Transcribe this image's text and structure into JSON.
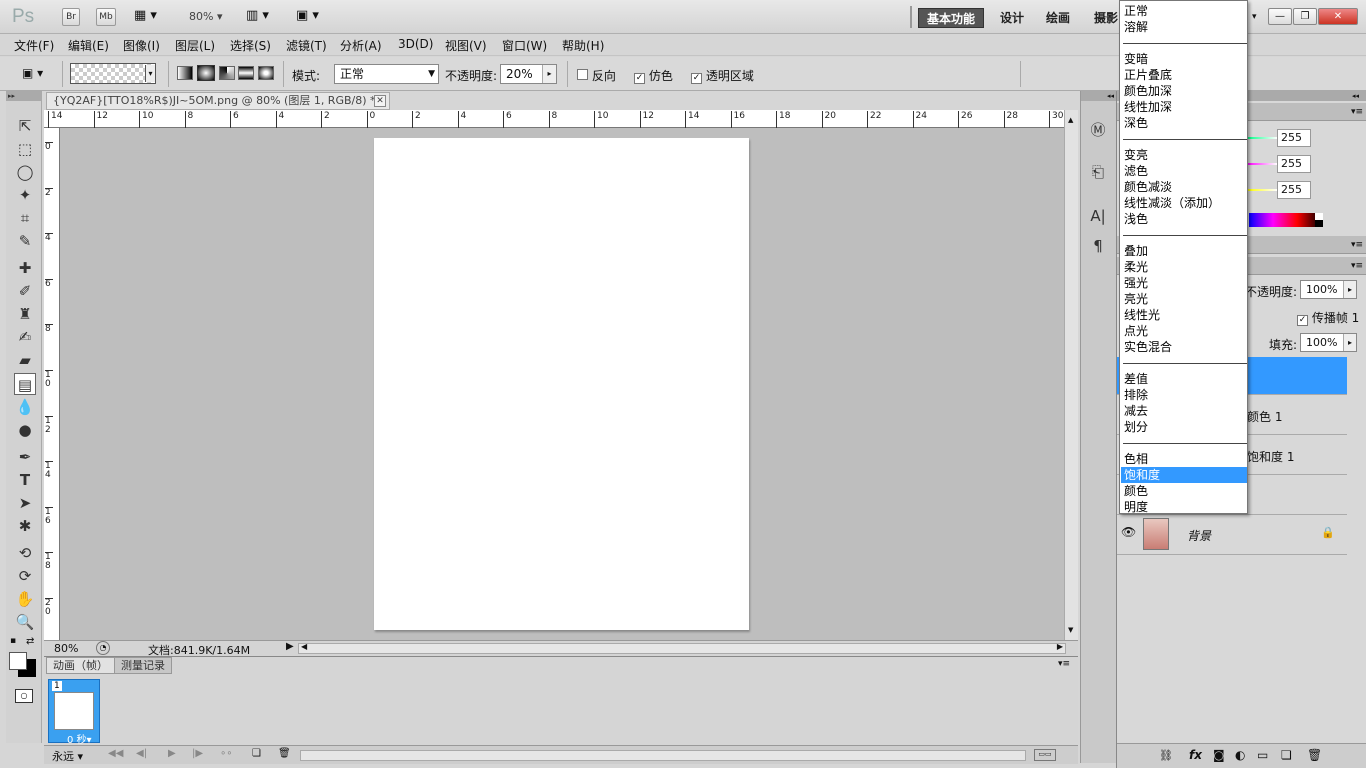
{
  "app": {
    "logo": "Ps",
    "bridge": "Br",
    "minibridge": "Mb",
    "zoom": "80%"
  },
  "workspaces": {
    "basic": "基本功能",
    "design": "设计",
    "paint": "绘画",
    "photo": "摄影"
  },
  "menus": [
    "文件(F)",
    "编辑(E)",
    "图像(I)",
    "图层(L)",
    "选择(S)",
    "滤镜(T)",
    "分析(A)",
    "3D(D)",
    "视图(V)",
    "窗口(W)",
    "帮助(H)"
  ],
  "options": {
    "mode_label": "模式:",
    "mode_value": "正常",
    "opacity_label": "不透明度:",
    "opacity_value": "20%",
    "reverse": "反向",
    "dither": "仿色",
    "transparency": "透明区域"
  },
  "document": {
    "tab_title": "{YQ2AF}[TTO18%R$)JI~5OM.png @ 80% (图层 1, RGB/8) *",
    "zoom": "80%",
    "doc_size": "文档:841.9K/1.64M"
  },
  "ruler_top": [
    "14",
    "12",
    "10",
    "8",
    "6",
    "4",
    "2",
    "0",
    "2",
    "4",
    "6",
    "8",
    "10",
    "12",
    "14",
    "16",
    "18",
    "20",
    "22",
    "24",
    "26",
    "28",
    "30"
  ],
  "ruler_left": [
    "0",
    "2",
    "4",
    "6",
    "8",
    "10",
    "12",
    "14",
    "16",
    "18",
    "20"
  ],
  "animation": {
    "tab_anim": "动画（帧）",
    "tab_measure": "测量记录",
    "frame_number": "1",
    "frame_delay": "0 秒",
    "loop": "永远"
  },
  "color_panel": {
    "r": "255",
    "g": "255",
    "b": "255"
  },
  "layers_panel": {
    "opacity_label": "不透明度:",
    "opacity_value": "100%",
    "propagate": "传播帧 1",
    "fill_label": "填充:",
    "fill_value": "100%",
    "layers": [
      "颜色 1",
      "饱和度 1",
      "背景"
    ]
  },
  "blend_modes": {
    "groups": [
      [
        "正常",
        "溶解"
      ],
      [
        "变暗",
        "正片叠底",
        "颜色加深",
        "线性加深",
        "深色"
      ],
      [
        "变亮",
        "滤色",
        "颜色减淡",
        "线性减淡（添加）",
        "浅色"
      ],
      [
        "叠加",
        "柔光",
        "强光",
        "亮光",
        "线性光",
        "点光",
        "实色混合"
      ],
      [
        "差值",
        "排除",
        "减去",
        "划分"
      ],
      [
        "色相",
        "饱和度",
        "颜色",
        "明度"
      ]
    ],
    "selected": "饱和度"
  }
}
